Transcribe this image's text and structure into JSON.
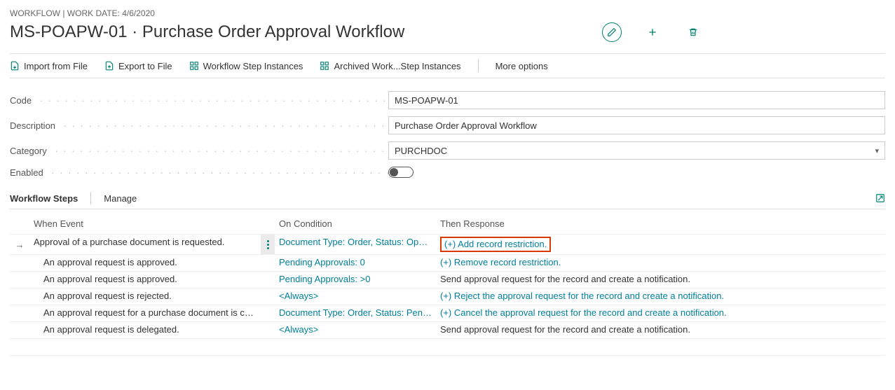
{
  "header": {
    "breadcrumb": "WORKFLOW | WORK DATE: 4/6/2020",
    "title": "MS-POAPW-01 · Purchase Order Approval Workflow"
  },
  "toolbar": {
    "import": "Import from File",
    "export": "Export to File",
    "step_instances": "Workflow Step Instances",
    "archived": "Archived Work...Step Instances",
    "more": "More options"
  },
  "fields": {
    "code_label": "Code",
    "code_value": "MS-POAPW-01",
    "desc_label": "Description",
    "desc_value": "Purchase Order Approval Workflow",
    "cat_label": "Category",
    "cat_value": "PURCHDOC",
    "enabled_label": "Enabled"
  },
  "section": {
    "title": "Workflow Steps",
    "manage": "Manage"
  },
  "grid": {
    "headers": {
      "event": "When Event",
      "condition": "On Condition",
      "response": "Then Response"
    },
    "rows": [
      {
        "event": "Approval of a purchase document is requested.",
        "condition": "Document Type: Order, Status: Open, ...",
        "response": "(+) Add record restriction.",
        "indent": false,
        "selected": true,
        "cond_link": true,
        "resp_link": true,
        "highlight": true
      },
      {
        "event": "An approval request is approved.",
        "condition": "Pending Approvals: 0",
        "response": "(+) Remove record restriction.",
        "indent": true,
        "cond_link": true,
        "resp_link": true
      },
      {
        "event": "An approval request is approved.",
        "condition": "Pending Approvals: >0",
        "response": "Send approval request for the record and create a notification.",
        "indent": true,
        "cond_link": true,
        "resp_link": false
      },
      {
        "event": "An approval request is rejected.",
        "condition": "<Always>",
        "response": "(+) Reject the approval request for the record and create a notification.",
        "indent": true,
        "cond_link": true,
        "resp_link": true
      },
      {
        "event": "An approval request for a purchase document is ca...",
        "condition": "Document Type: Order, Status: Pendin...",
        "response": "(+) Cancel the approval request for the record and create a notification.",
        "indent": true,
        "cond_link": true,
        "resp_link": true
      },
      {
        "event": "An approval request is delegated.",
        "condition": "<Always>",
        "response": "Send approval request for the record and create a notification.",
        "indent": true,
        "cond_link": true,
        "resp_link": false
      }
    ]
  }
}
